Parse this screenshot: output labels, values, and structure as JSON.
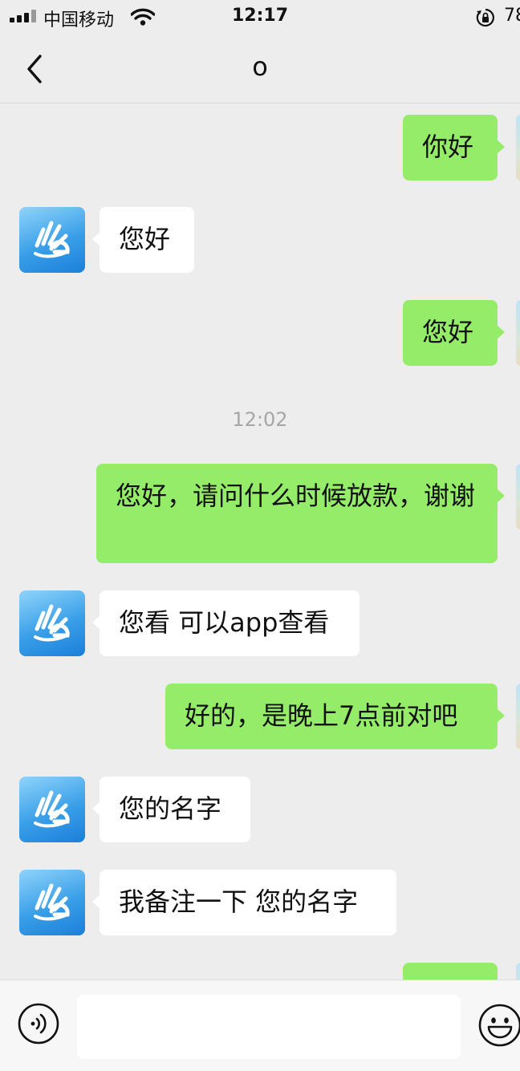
{
  "status_bar": {
    "carrier": "中国移动",
    "time": "12:17",
    "battery": "78",
    "icons": [
      "signal-bars-icon",
      "wifi-icon",
      "orientation-lock-icon"
    ]
  },
  "header": {
    "title": "o",
    "back_icon": "chevron-left-icon"
  },
  "messages": [
    {
      "from": "me",
      "text": "你好"
    },
    {
      "from": "other",
      "text": "您好"
    },
    {
      "from": "me",
      "text": "您好"
    },
    {
      "type": "timestamp",
      "text": "12:02"
    },
    {
      "from": "me",
      "text": "您好，请问什么时候放款，谢谢"
    },
    {
      "from": "other",
      "text": "您看 可以app查看"
    },
    {
      "from": "me",
      "text": "好的，是晚上7点前对吧"
    },
    {
      "from": "other",
      "text": "您的名字"
    },
    {
      "from": "other",
      "text": "我备注一下 您的名字"
    },
    {
      "from": "me",
      "text": ""
    }
  ],
  "input_bar": {
    "voice_icon": "voice-icon",
    "emoji_icon": "emoji-icon",
    "text_value": ""
  },
  "colors": {
    "background": "#ededed",
    "my_bubble": "#95ec69",
    "their_bubble": "#ffffff",
    "timestamp": "#a6a6a6"
  }
}
